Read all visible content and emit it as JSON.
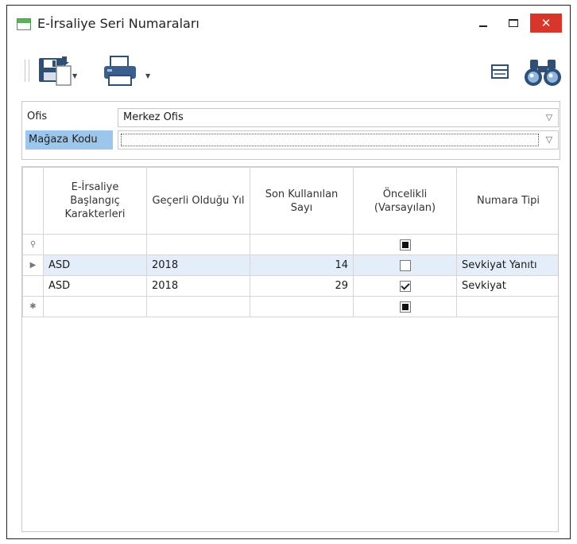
{
  "window": {
    "title": "E-İrsaliye Seri Numaraları",
    "minimize": "",
    "maximize": "",
    "close": "✕"
  },
  "filters": {
    "office_label": "Ofis",
    "office_value": "Merkez Ofis",
    "store_label": "Mağaza Kodu",
    "store_value": ""
  },
  "grid": {
    "columns": [
      "E-İrsaliye Başlangıç Karakterleri",
      "Geçerli Olduğu Yıl",
      "Son Kullanılan Sayı",
      "Öncelikli (Varsayılan)",
      "Numara Tipi"
    ],
    "filter_row": {
      "indicator": "⚲",
      "default": "indeterminate"
    },
    "rows": [
      {
        "indicator": "▶",
        "prefix": "ASD",
        "year": "2018",
        "last": "14",
        "default": "unchecked",
        "type": "Sevkiyat Yanıtı"
      },
      {
        "indicator": "",
        "prefix": "ASD",
        "year": "2018",
        "last": "29",
        "default": "checked",
        "type": "Sevkiyat"
      }
    ],
    "new_row": {
      "indicator": "✱",
      "default": "indeterminate"
    }
  },
  "icons": {
    "title": "form-icon",
    "save": "save-icon",
    "print": "printer-icon",
    "layout": "layout-icon",
    "find": "binoculars-icon"
  },
  "colors": {
    "selected_label_bg": "#9cc6ec",
    "selected_row_bg": "#e3eefa",
    "close_button": "#d9362b"
  }
}
